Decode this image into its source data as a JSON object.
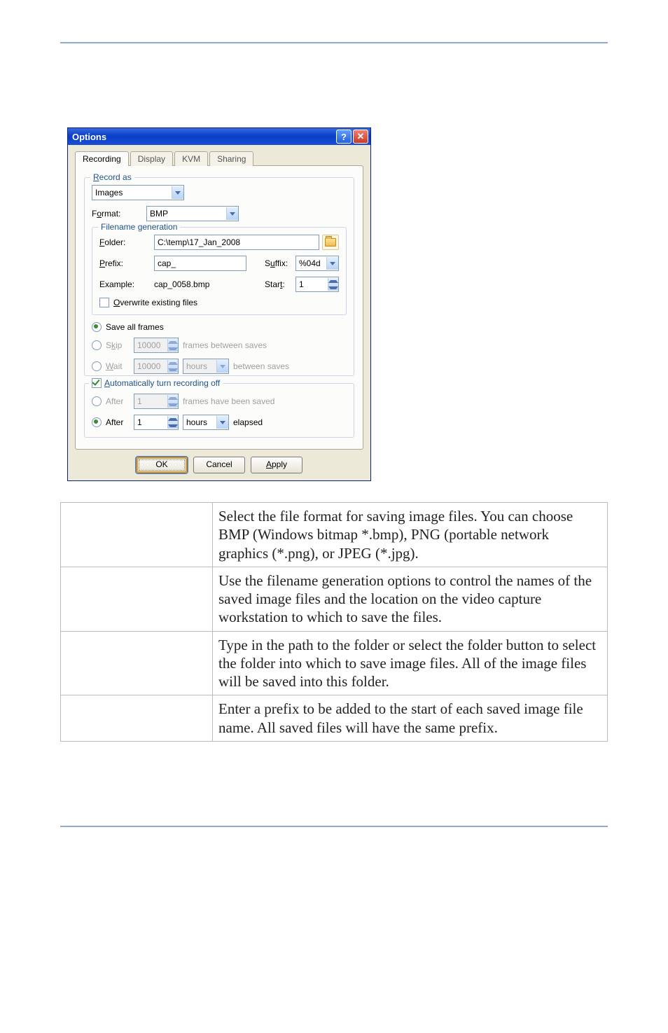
{
  "dialog": {
    "title": "Options",
    "tabs": [
      "Recording",
      "Display",
      "KVM",
      "Sharing"
    ],
    "active_tab": 0,
    "record_as_label": "Record as",
    "record_as_value": "Images",
    "format_label": "Format:",
    "format_value": "BMP",
    "filename_group_title": "Filename generation",
    "folder_label": "Folder:",
    "folder_value": "C:\\temp\\17_Jan_2008",
    "prefix_label": "Prefix:",
    "prefix_value": "cap_",
    "suffix_label": "Suffix:",
    "suffix_value": "%04d",
    "example_label": "Example:",
    "example_value": "cap_0058.bmp",
    "start_label": "Start:",
    "start_value": "1",
    "overwrite_label": "Overwrite existing files",
    "save_all_label": "Save all frames",
    "skip_label": "Skip",
    "skip_value": "10000",
    "skip_after": "frames between saves",
    "wait_label": "Wait",
    "wait_value": "10000",
    "wait_unit": "hours",
    "wait_after": "between saves",
    "auto_off_label": "Automatically turn recording off",
    "after_frames_label": "After",
    "after_frames_value": "1",
    "after_frames_text": "frames have been saved",
    "after_time_label": "After",
    "after_time_value": "1",
    "after_time_unit": "hours",
    "after_time_text": "elapsed",
    "buttons": {
      "ok": "OK",
      "cancel": "Cancel",
      "apply": "Apply"
    }
  },
  "doc": [
    "Select the file format for saving image files. You can choose BMP (Windows bitmap *.bmp), PNG (portable network graphics (*.png), or JPEG (*.jpg).",
    "Use the filename generation options to control the names of the saved image files and the location on the video capture workstation to which to save the files.",
    "Type in the path to the folder or select the folder button to select the folder into which to save image files. All of the image files will be saved into this folder.",
    "Enter a prefix to be added to the start of each saved image file name. All saved files will have the same prefix."
  ],
  "u": {
    "R": "R",
    "F": "F",
    "o": "o",
    "P": "P",
    "u": "u",
    "t": "t",
    "O": "O",
    "k": "k",
    "W": "W",
    "A": "A"
  }
}
